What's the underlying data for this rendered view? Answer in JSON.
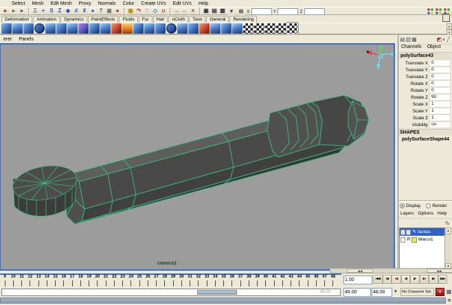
{
  "colors": {
    "selection_blue": "#2f62c4",
    "panel_border_blue": "#3b6ec9",
    "wireframe_green": "#3cb67e",
    "beige": "#ece9d8",
    "layer_swatch": "#f5e642",
    "autokey_red": "#b01808"
  },
  "menubar": {
    "items": [
      "Select",
      "Mesh",
      "Edit Mesh",
      "Proxy",
      "Normals",
      "Color",
      "Create UVs",
      "Edit UVs",
      "Help"
    ]
  },
  "statusline": {
    "icons": [
      {
        "name": "selection-mask-icon",
        "g": "▸",
        "c": "#a03020"
      },
      {
        "name": "lasso-select-icon",
        "g": "▸",
        "c": "#3a7d3a"
      },
      {
        "name": "paint-select-icon",
        "g": "▸",
        "c": "#7a3a8a"
      },
      {
        "name": "separator",
        "sep": true
      },
      {
        "name": "highlight-mode-icon",
        "g": "Ξ",
        "c": "#555566"
      },
      {
        "name": "select-points-icon",
        "g": "+",
        "c": "#2a58b8"
      },
      {
        "name": "select-curves-icon",
        "g": "S",
        "c": "#2a58b8"
      },
      {
        "name": "select-surfaces-icon",
        "g": "Z",
        "c": "#2a58b8"
      },
      {
        "name": "select-deformations-icon",
        "g": "◆",
        "c": "#2a58b8"
      },
      {
        "name": "select-rendering-icon",
        "g": "#",
        "c": "#2a58b8"
      },
      {
        "name": "select-dynamics-icon",
        "g": "¥",
        "c": "#2a58b8"
      },
      {
        "name": "select-misc-icon",
        "g": "●",
        "c": "#2a58b8"
      },
      {
        "name": "help-mode-icon",
        "g": "?",
        "c": "#2a58b8"
      },
      {
        "name": "lock-icon",
        "g": "▣",
        "c": "#777766"
      },
      {
        "name": "highlight-selection-icon",
        "g": "●",
        "c": "#aa2233"
      },
      {
        "name": "separator",
        "sep": true
      },
      {
        "name": "snap-to-grids-icon",
        "g": "▦",
        "c": "#b89010"
      },
      {
        "name": "snap-to-curves-icon",
        "g": "↷",
        "c": "#bb3333"
      },
      {
        "name": "snap-to-points-icon",
        "g": "∵",
        "c": "#aa33aa"
      },
      {
        "name": "snap-to-planes-icon",
        "g": "◇",
        "c": "#3377bb"
      },
      {
        "name": "make-live-icon",
        "g": "∪",
        "c": "#bb3333"
      },
      {
        "name": "separator",
        "sep": true
      },
      {
        "name": "input-connections-icon",
        "g": "→",
        "c": "#555555"
      },
      {
        "name": "output-connections-icon",
        "g": "←",
        "c": "#555555"
      },
      {
        "name": "construction-history-icon",
        "g": "×",
        "c": "#883333"
      },
      {
        "name": "separator",
        "sep": true
      },
      {
        "name": "render-view-icon",
        "g": "▣",
        "c": "#333344"
      },
      {
        "name": "ipr-render-icon",
        "g": "▤",
        "c": "#333344"
      },
      {
        "name": "render-settings-icon",
        "g": "▩",
        "c": "#333344"
      }
    ],
    "combo_arrow": "▼",
    "combo_grid": "⊞",
    "x_label": "X",
    "y_label": "Y",
    "z_label": "Z",
    "x_value": "",
    "y_value": "",
    "z_value": ""
  },
  "shelf": {
    "tabs": [
      "Deformation",
      "Animation",
      "Dynamics",
      "PaintEffects",
      "Fluids",
      "Fur",
      "Hair",
      "nCloth",
      "Toon",
      "General",
      "Rendering"
    ],
    "items": [
      {
        "type": "p1"
      },
      {
        "type": "p2"
      },
      {
        "type": "p1"
      },
      {
        "type": "p3"
      },
      {
        "type": "p2"
      },
      {
        "type": "p1"
      },
      {
        "type": "p2"
      },
      {
        "type": "p4"
      },
      {
        "type": "p1"
      },
      {
        "type": "p2"
      },
      {
        "type": "red"
      },
      {
        "type": "fire"
      },
      {
        "type": "p1"
      },
      {
        "type": "p2"
      },
      {
        "type": "p1"
      },
      {
        "type": "p3"
      },
      {
        "type": "p2"
      },
      {
        "type": "p1"
      },
      {
        "type": "red"
      },
      {
        "type": "p2"
      },
      {
        "type": "p1"
      },
      {
        "type": "p2"
      },
      {
        "type": "chk"
      },
      {
        "type": "chk"
      },
      {
        "type": "chk"
      },
      {
        "type": "chk"
      },
      {
        "type": "chks"
      }
    ],
    "scroll_up": "▲",
    "scroll_down": "▼"
  },
  "viewport": {
    "menu_items": [
      "erer",
      "Panels"
    ],
    "camera_label": "camera1"
  },
  "channel_box": {
    "layout_icons": [
      "▤",
      "▥",
      "▦"
    ],
    "right_icons": [
      "◩",
      "◐",
      "╱"
    ],
    "menus": [
      "Channels",
      "Object"
    ],
    "object_name": "polySurface43",
    "attributes": [
      {
        "label": "Translate X",
        "value": "0"
      },
      {
        "label": "Translate Y",
        "value": "0"
      },
      {
        "label": "Translate Z",
        "value": "0"
      },
      {
        "label": "Rotate X",
        "value": "0"
      },
      {
        "label": "Rotate Y",
        "value": "0"
      },
      {
        "label": "Rotate Z",
        "value": "90"
      },
      {
        "label": "Scale X",
        "value": "1"
      },
      {
        "label": "Scale Y",
        "value": "1"
      },
      {
        "label": "Scale Z",
        "value": "1"
      },
      {
        "label": "Visibility",
        "value": "on"
      }
    ],
    "shapes_header": "SHAPES",
    "shape_name": "polySurfaceShape44"
  },
  "layer_editor": {
    "display_radio": "Display",
    "render_radio": "Render",
    "selected_mode": "Display",
    "menus": [
      "Layers",
      "Options",
      "Help"
    ],
    "new_layer_icon": "✎",
    "layers": [
      {
        "name": "llantas",
        "icon": "✎",
        "selected": true
      },
      {
        "name": "Marco1",
        "badge": "R",
        "color": "#f5e642"
      }
    ],
    "scroll_up": "▲",
    "scroll_down": "▼"
  },
  "hscroll": {
    "left_glyph": "◀◀",
    "right_glyph": "▶▶"
  },
  "timeline": {
    "frames": [
      "9",
      "10",
      "11",
      "12",
      "13",
      "14",
      "15",
      "16",
      "17",
      "18",
      "19",
      "20",
      "21",
      "22",
      "23",
      "24",
      "25",
      "26",
      "27",
      "28",
      "29",
      "30",
      "31",
      "32",
      "33",
      "34",
      "35",
      "36",
      "37",
      "38",
      "39",
      "40",
      "41",
      "42",
      "43",
      "44",
      "45",
      "46",
      "47",
      "48"
    ],
    "current_time": "1.00"
  },
  "playback": {
    "buttons": [
      {
        "name": "go-to-start-button",
        "g": "|◀◀"
      },
      {
        "name": "step-back-frame-button",
        "g": "|◀"
      },
      {
        "name": "step-back-key-button",
        "g": "|◀",
        "red": true
      },
      {
        "name": "play-backwards-button",
        "g": "◀"
      },
      {
        "name": "play-forwards-button",
        "g": "▶"
      },
      {
        "name": "step-forward-key-button",
        "g": "▶|",
        "red": true
      },
      {
        "name": "step-forward-frame-button",
        "g": "▶|"
      },
      {
        "name": "go-to-end-button",
        "g": "▶▶|"
      }
    ]
  },
  "range_slider": {
    "trough_end_label": "48.00",
    "start": "48.00",
    "end": "48.00",
    "dropdown_arrow": "▼",
    "character_set": "No Character Set",
    "autokey_glyph": "●",
    "grid_icon": "▦"
  },
  "command_line": {
    "icon": "≣"
  }
}
